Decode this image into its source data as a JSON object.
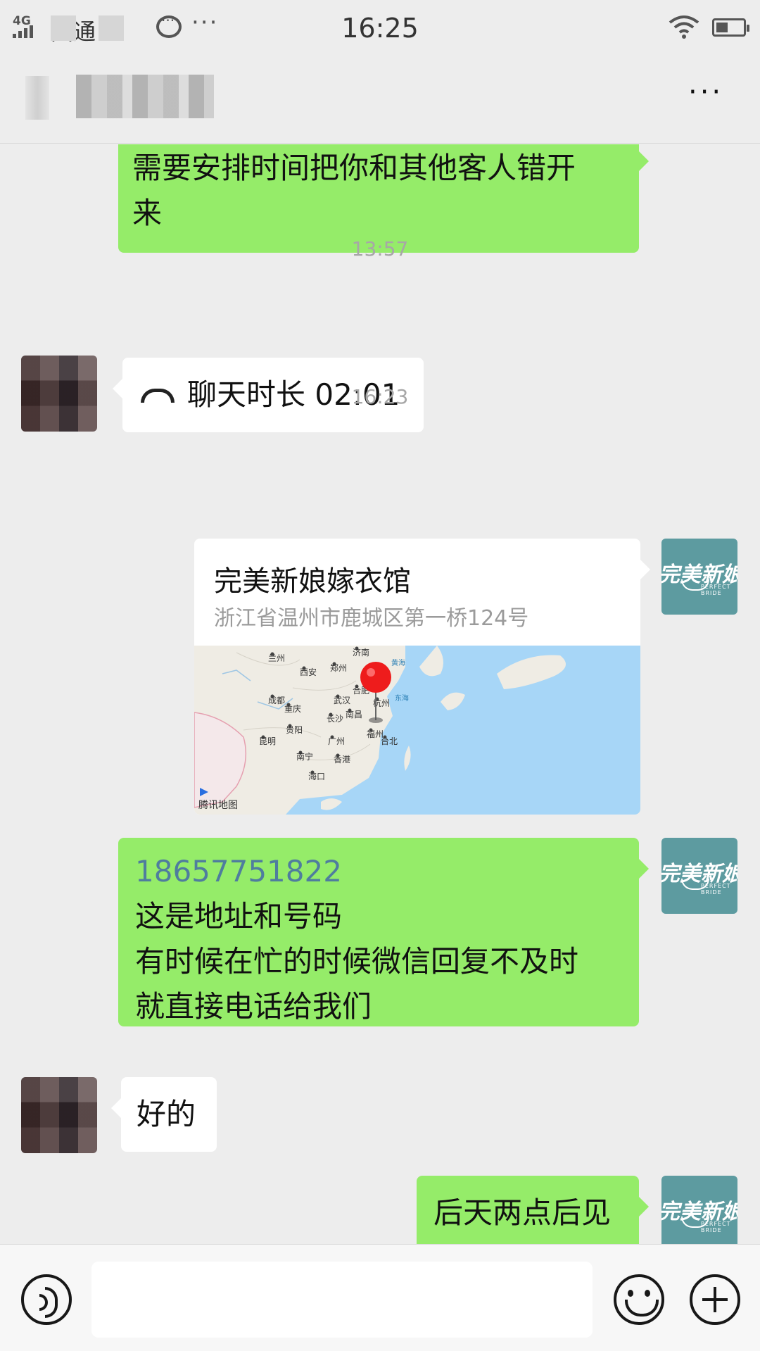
{
  "status_bar": {
    "network": "4G",
    "carrier": "国通",
    "time": "16:25",
    "more": "···"
  },
  "header": {
    "more": "···"
  },
  "messages": [
    {
      "type": "text",
      "side": "out",
      "lines": [
        "需要安排时间把你和其他客人错开",
        "来"
      ]
    },
    {
      "type": "time",
      "text": "13:57"
    },
    {
      "type": "call",
      "side": "in",
      "text": "聊天时长 02:01"
    },
    {
      "type": "time",
      "text": "16:23"
    },
    {
      "type": "location",
      "side": "out",
      "name": "完美新娘嫁衣馆",
      "address": "浙江省温州市鹿城区第一桥124号",
      "map_credit": "腾讯地图",
      "map_labels": [
        "兰州",
        "西安",
        "郑州",
        "济南",
        "黄海",
        "合肥",
        "东海",
        "成都",
        "重庆",
        "武汉",
        "杭州",
        "长沙",
        "南昌",
        "贵阳",
        "昆明",
        "广州",
        "福州",
        "台北",
        "南宁",
        "香港",
        "海口"
      ]
    },
    {
      "type": "text",
      "side": "out",
      "phone": "18657751822",
      "lines": [
        "这是地址和号码",
        "有时候在忙的时候微信回复不及时",
        "就直接电话给我们"
      ]
    },
    {
      "type": "text",
      "side": "in",
      "lines": [
        "好的"
      ]
    },
    {
      "type": "text",
      "side": "out",
      "lines": [
        "后天两点后见"
      ]
    }
  ],
  "avatar_out": {
    "logo_text": "完美新娘",
    "logo_sub": "PERFECT BRIDE"
  },
  "colors": {
    "out_bubble": "#95ec69",
    "in_bubble": "#ffffff",
    "background": "#ededed",
    "avatar_out": "#5d9ba0"
  },
  "bottom_bar": {
    "input_placeholder": ""
  }
}
